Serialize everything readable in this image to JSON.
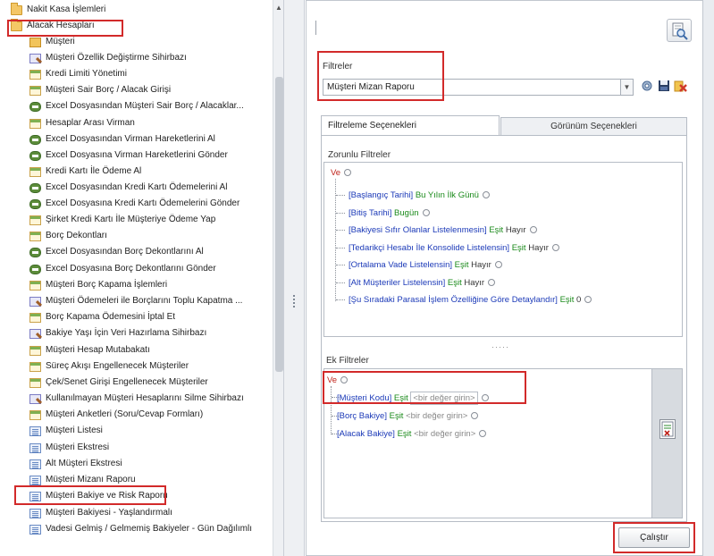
{
  "tree": {
    "items": [
      {
        "label": "Nakit Kasa İşlemleri",
        "icon": "folder-icon"
      },
      {
        "label": "Alacak Hesapları",
        "icon": "folder-icon"
      },
      {
        "label": "Müşteri",
        "icon": "item-icon"
      },
      {
        "label": "Müşteri Özellik Değiştirme Sihirbazı",
        "icon": "wizard-icon"
      },
      {
        "label": "Kredi Limiti Yönetimi",
        "icon": "form-icon"
      },
      {
        "label": "Müşteri Sair Borç / Alacak Girişi",
        "icon": "form-icon"
      },
      {
        "label": "Excel Dosyasından Müşteri Sair Borç / Alacaklar...",
        "icon": "excel-icon"
      },
      {
        "label": "Hesaplar Arası Virman",
        "icon": "form-icon"
      },
      {
        "label": "Excel Dosyasından Virman Hareketlerini Al",
        "icon": "excel-icon"
      },
      {
        "label": "Excel Dosyasına Virman Hareketlerini Gönder",
        "icon": "excel-icon"
      },
      {
        "label": "Kredi Kartı İle Ödeme Al",
        "icon": "form-icon"
      },
      {
        "label": "Excel Dosyasından Kredi Kartı Ödemelerini Al",
        "icon": "excel-icon"
      },
      {
        "label": "Excel Dosyasına Kredi Kartı Ödemelerini Gönder",
        "icon": "excel-icon"
      },
      {
        "label": "Şirket Kredi Kartı İle Müşteriye Ödeme Yap",
        "icon": "form-icon"
      },
      {
        "label": "Borç Dekontları",
        "icon": "form-icon"
      },
      {
        "label": "Excel Dosyasından Borç Dekontlarını Al",
        "icon": "excel-icon"
      },
      {
        "label": "Excel Dosyasına Borç Dekontlarını Gönder",
        "icon": "excel-icon"
      },
      {
        "label": "Müşteri Borç Kapama İşlemleri",
        "icon": "form-icon"
      },
      {
        "label": "Müşteri Ödemeleri ile Borçlarını Toplu Kapatma ...",
        "icon": "wizard-icon"
      },
      {
        "label": "Borç Kapama Ödemesini İptal Et",
        "icon": "form-icon"
      },
      {
        "label": "Bakiye Yaşı İçin Veri Hazırlama Sihirbazı",
        "icon": "wizard-icon"
      },
      {
        "label": "Müşteri Hesap Mutabakatı",
        "icon": "form-icon"
      },
      {
        "label": "Süreç Akışı Engellenecek Müşteriler",
        "icon": "form-icon"
      },
      {
        "label": "Çek/Senet Girişi Engellenecek Müşteriler",
        "icon": "form-icon"
      },
      {
        "label": "Kullanılmayan Müşteri Hesaplarını Silme Sihirbazı",
        "icon": "wizard-icon"
      },
      {
        "label": "Müşteri Anketleri (Soru/Cevap Formları)",
        "icon": "form-icon"
      },
      {
        "label": "Müşteri Listesi",
        "icon": "report-icon"
      },
      {
        "label": "Müşteri Ekstresi",
        "icon": "report-icon"
      },
      {
        "label": "Alt Müşteri Ekstresi",
        "icon": "report-icon"
      },
      {
        "label": "Müşteri Mizanı Raporu",
        "icon": "report-icon"
      },
      {
        "label": "Müşteri Bakiye ve Risk Raporu",
        "icon": "report-icon"
      },
      {
        "label": "Müşteri Bakiyesi - Yaşlandırmalı",
        "icon": "report-icon"
      },
      {
        "label": "Vadesi Gelmiş / Gelmemiş Bakiyeler - Gün Dağılımlı",
        "icon": "report-icon"
      }
    ]
  },
  "right": {
    "filters_label": "Filtreler",
    "selected_filter": "Müşteri Mizan Raporu",
    "tabs": {
      "filter_options": "Filtreleme Seçenekleri",
      "view_options": "Görünüm Seçenekleri"
    },
    "required_filters": {
      "label": "Zorunlu Filtreler",
      "and_op": "Ve",
      "rows": [
        {
          "field": "[Başlangıç Tarihi]",
          "op": "Bu Yılın İlk Günü",
          "value": ""
        },
        {
          "field": "[Bitiş Tarihi]",
          "op": "Bugün",
          "value": ""
        },
        {
          "field": "[Bakiyesi Sıfır Olanlar Listelenmesin]",
          "op": "Eşit",
          "value": "Hayır"
        },
        {
          "field": "[Tedarikçi Hesabı İle Konsolide Listelensin]",
          "op": "Eşit",
          "value": "Hayır"
        },
        {
          "field": "[Ortalama Vade Listelensin]",
          "op": "Eşit",
          "value": "Hayır"
        },
        {
          "field": "[Alt Müşteriler Listelensin]",
          "op": "Eşit",
          "value": "Hayır"
        },
        {
          "field": "[Şu Sıradaki Parasal İşlem Özelliğine Göre Detaylandır]",
          "op": "Eşit",
          "value": "0"
        }
      ]
    },
    "extra_filters": {
      "label": "Ek Filtreler",
      "and_op": "Ve",
      "rows": [
        {
          "field": "[Müşteri Kodu]",
          "op": "Eşit",
          "placeholder": "<bir değer girin>"
        },
        {
          "field": "[Borç Bakiye]",
          "op": "Eşit",
          "placeholder": "<bir değer girin>"
        },
        {
          "field": "[Alacak Bakiye]",
          "op": "Eşit",
          "placeholder": "<bir değer girin>"
        }
      ]
    },
    "divider": "·····",
    "run_button": "Çalıştır"
  },
  "colors": {
    "highlight_border": "#d22a2a",
    "field_text": "#1c3ab8",
    "operator_text": "#1a8a1a",
    "and_operator": "#c0241c"
  }
}
